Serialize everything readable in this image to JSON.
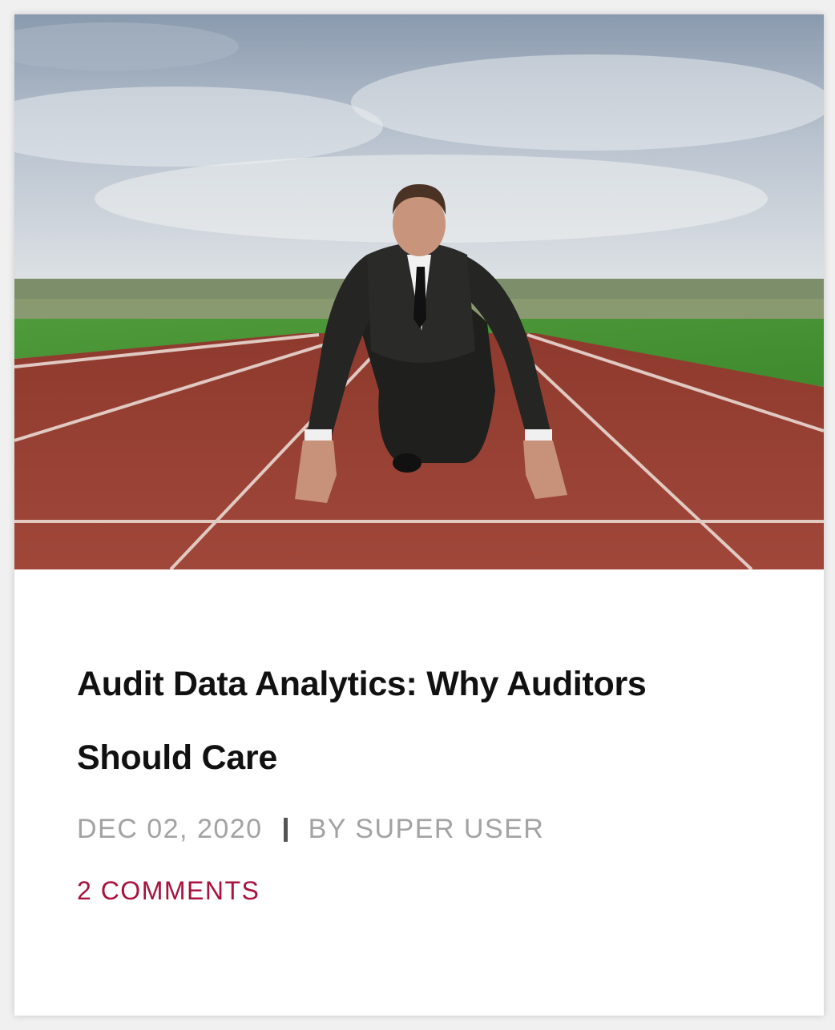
{
  "colors": {
    "title": "#111111",
    "meta": "#a3a3a3",
    "separator": "#555555",
    "comments_link": "#a8123c"
  },
  "post": {
    "image_alt": "Businessman in suit crouched at start line of running track",
    "title": "Audit Data Analytics: Why Auditors Should Care",
    "date": "DEC 02, 2020",
    "author": "BY SUPER USER",
    "comments": "2 COMMENTS"
  }
}
